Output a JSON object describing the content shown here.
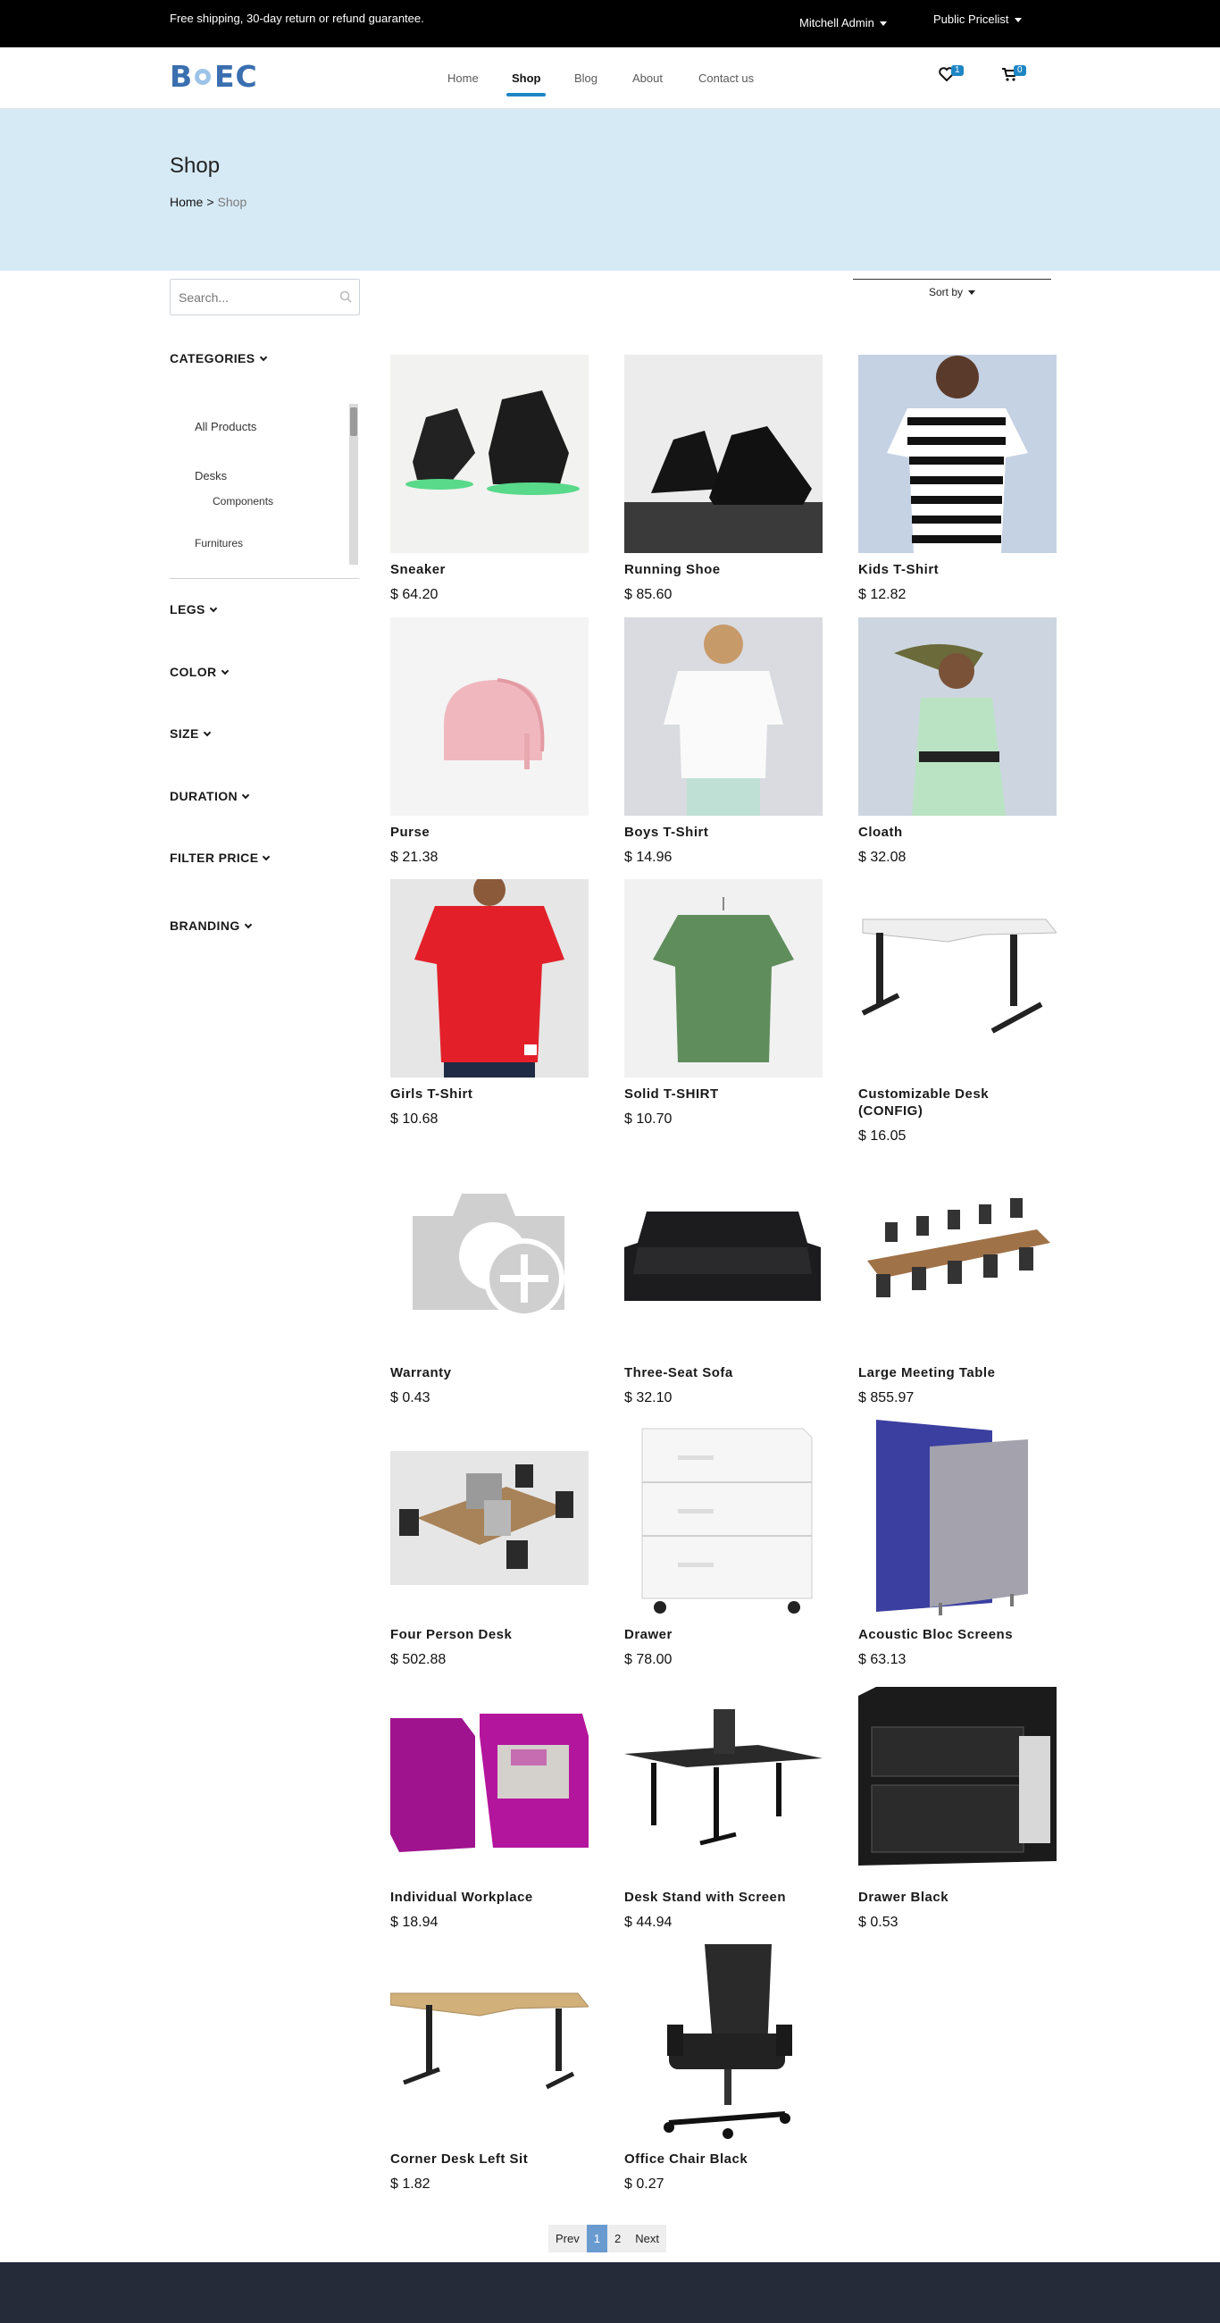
{
  "topbar": {
    "promo": "Free shipping, 30-day return or refund guarantee.",
    "user": "Mitchell Admin",
    "pricelist": "Public Pricelist"
  },
  "brand": {
    "logo": "B EC"
  },
  "nav": {
    "items": [
      "Home",
      "Shop",
      "Blog",
      "About",
      "Contact us"
    ],
    "active": "Shop",
    "wishlist_count": "1",
    "cart_count": "0"
  },
  "hero": {
    "title": "Shop",
    "breadcrumb_home": "Home",
    "breadcrumb_sep": ">",
    "breadcrumb_current": "Shop"
  },
  "search": {
    "placeholder": "Search..."
  },
  "sort": {
    "label": "Sort by"
  },
  "filters": {
    "categories": "CATEGORIES",
    "category_items": [
      "All Products",
      "Desks",
      "Components",
      "Furnitures"
    ],
    "legs": "LEGS",
    "color": "COLOR",
    "size": "SIZE",
    "duration": "DURATION",
    "filter_price": "FILTER PRICE",
    "branding": "BRANDING"
  },
  "products": [
    {
      "name": "Sneaker",
      "price": "$ 64.20"
    },
    {
      "name": "Running Shoe",
      "price": "$ 85.60"
    },
    {
      "name": "Kids T-Shirt",
      "price": "$ 12.82"
    },
    {
      "name": "Purse",
      "price": "$ 21.38"
    },
    {
      "name": "Boys T-Shirt",
      "price": "$ 14.96"
    },
    {
      "name": "Cloath",
      "price": "$ 32.08"
    },
    {
      "name": "Girls T-Shirt",
      "price": "$ 10.68"
    },
    {
      "name": "Solid T-SHIRT",
      "price": "$ 10.70"
    },
    {
      "name": "Customizable Desk (CONFIG)",
      "price": "$ 16.05"
    },
    {
      "name": "Warranty",
      "price": "$ 0.43"
    },
    {
      "name": "Three-Seat Sofa",
      "price": "$ 32.10"
    },
    {
      "name": "Large Meeting Table",
      "price": "$ 855.97"
    },
    {
      "name": "Four Person Desk",
      "price": "$ 502.88"
    },
    {
      "name": "Drawer",
      "price": "$ 78.00"
    },
    {
      "name": "Acoustic Bloc Screens",
      "price": "$ 63.13"
    },
    {
      "name": "Individual Workplace",
      "price": "$ 18.94"
    },
    {
      "name": "Desk Stand with Screen",
      "price": "$ 44.94"
    },
    {
      "name": "Drawer Black",
      "price": "$ 0.53"
    },
    {
      "name": "Corner Desk Left Sit",
      "price": "$ 1.82"
    },
    {
      "name": "Office Chair Black",
      "price": "$ 0.27"
    }
  ],
  "pagination": {
    "prev": "Prev",
    "page1": "1",
    "page2": "2",
    "next": "Next"
  },
  "colors": {
    "accent": "#1f86c4",
    "hero_bg": "#d6eaf6",
    "topbar_bg": "#000000",
    "footer_bg": "#252b38"
  }
}
